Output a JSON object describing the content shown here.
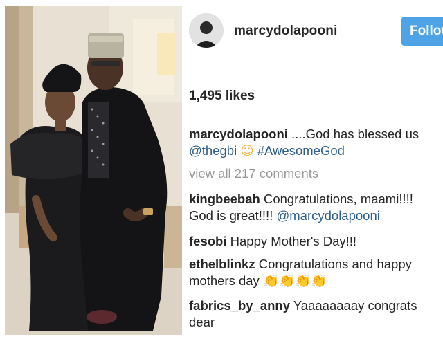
{
  "post": {
    "username": "marcydolapooni",
    "follow_label": "Follow",
    "likes": "1,495 likes",
    "caption": {
      "user": "marcydolapooni",
      "text": "....God has blessed us",
      "mention": "@thegbi",
      "emoji": "☺",
      "hashtag": "#AwesomeGod"
    },
    "view_all": "view all 217 comments",
    "comments": [
      {
        "user": "kingbeebah",
        "text": "Congratulations, maami!!!! God is great!!!! ",
        "mention": "@marcydolapooni",
        "emoji": ""
      },
      {
        "user": "fesobi",
        "text": "Happy Mother's Day!!!",
        "mention": "",
        "emoji": ""
      },
      {
        "user": "ethelblinkz",
        "text": "Congratulations and happy mothers day ",
        "mention": "",
        "emoji": "👏👏👏👏"
      },
      {
        "user": "fabrics_by_anny",
        "text": "Yaaaaaaaay congrats dear",
        "mention": "",
        "emoji": ""
      }
    ]
  },
  "colors": {
    "follow_button": "#4ea3e6",
    "link": "#2c5f8a",
    "muted": "#999999"
  }
}
